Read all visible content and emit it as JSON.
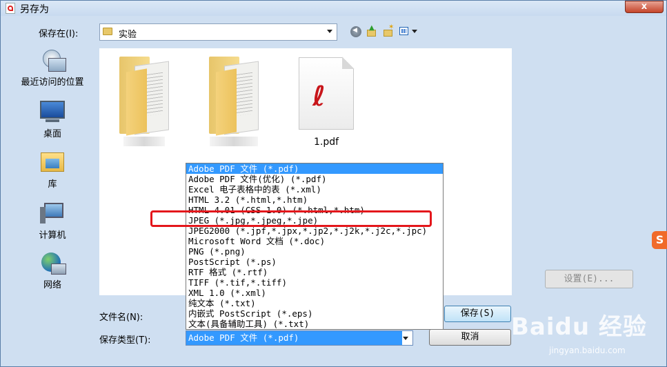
{
  "window": {
    "title": "另存为",
    "close_label": "x"
  },
  "save_in": {
    "label": "保存在(I):",
    "value": "实验"
  },
  "places": [
    {
      "label": "最近访问的位置",
      "icon": "recent-places-icon"
    },
    {
      "label": "桌面",
      "icon": "desktop-icon"
    },
    {
      "label": "库",
      "icon": "libraries-icon"
    },
    {
      "label": "计算机",
      "icon": "computer-icon"
    },
    {
      "label": "网络",
      "icon": "network-icon"
    }
  ],
  "files": [
    {
      "name": "",
      "type": "folder"
    },
    {
      "name": "",
      "type": "folder"
    },
    {
      "name": "1.pdf",
      "type": "pdf"
    }
  ],
  "filename": {
    "label": "文件名(N):",
    "value": ""
  },
  "filetype": {
    "label": "保存类型(T):",
    "value": "Adobe PDF 文件 (*.pdf)",
    "options": [
      "Adobe PDF 文件 (*.pdf)",
      "Adobe PDF 文件(优化) (*.pdf)",
      "Excel 电子表格中的表 (*.xml)",
      "HTML 3.2 (*.html,*.htm)",
      "HTML 4.01 (CSS 1.0) (*.html,*.htm)",
      "JPEG (*.jpg,*.jpeg,*.jpe)",
      "JPEG2000 (*.jpf,*.jpx,*.jp2,*.j2k,*.j2c,*.jpc)",
      "Microsoft Word 文档 (*.doc)",
      "PNG (*.png)",
      "PostScript (*.ps)",
      "RTF 格式 (*.rtf)",
      "TIFF (*.tif,*.tiff)",
      "XML 1.0 (*.xml)",
      "纯文本 (*.txt)",
      "内嵌式 PostScript (*.eps)",
      "文本(具备辅助工具) (*.txt)"
    ],
    "selected_index": 0,
    "highlighted_index": 5
  },
  "buttons": {
    "save": "保存(S)",
    "cancel": "取消",
    "settings": "设置(E)..."
  },
  "watermark": {
    "baidu": "Baidu 经验",
    "url": "jingyan.baidu.com",
    "sogou": "S"
  },
  "colors": {
    "selection": "#3399ff",
    "highlight_box": "#e4161b"
  }
}
